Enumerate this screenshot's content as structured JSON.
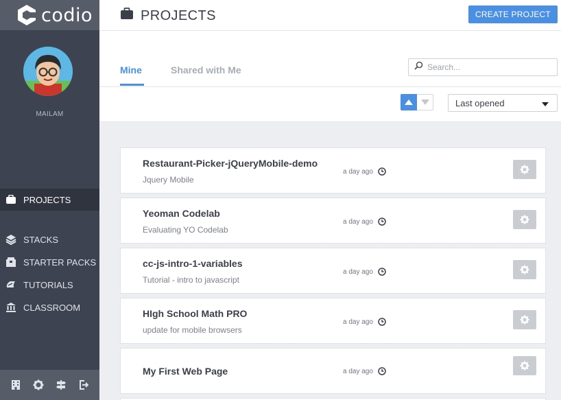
{
  "app": {
    "logo_text": "codio"
  },
  "sidebar": {
    "username": "MAILAM",
    "items": [
      {
        "label": "PROJECTS",
        "icon": "briefcase-icon",
        "active": true
      },
      {
        "label": "STACKS",
        "icon": "layers-icon"
      },
      {
        "label": "STARTER PACKS",
        "icon": "box-icon"
      },
      {
        "label": "TUTORIALS",
        "icon": "graduation-icon"
      },
      {
        "label": "CLASSROOM",
        "icon": "institution-icon"
      }
    ],
    "bottom_icons": [
      "building-icon",
      "gear-icon",
      "signpost-icon",
      "logout-icon"
    ]
  },
  "header": {
    "title": "PROJECTS",
    "create_button": "CREATE PROJECT"
  },
  "tabs": {
    "mine": "Mine",
    "shared": "Shared with Me",
    "active": "Mine"
  },
  "search": {
    "placeholder": "Search..."
  },
  "sort": {
    "selected": "Last opened",
    "direction": "ascending"
  },
  "projects": [
    {
      "name": "Restaurant-Picker-jQueryMobile-demo",
      "description": "Jquery Mobile",
      "time": "a day ago"
    },
    {
      "name": "Yeoman Codelab",
      "description": "Evaluating YO Codelab",
      "time": "a day ago"
    },
    {
      "name": "cc-js-intro-1-variables",
      "description": "Tutorial - intro to javascript",
      "time": "a day ago"
    },
    {
      "name": "HIgh School Math PRO",
      "description": "update for mobile browsers",
      "time": "a day ago"
    },
    {
      "name": "My First Web Page",
      "description": "",
      "time": "a day ago"
    }
  ],
  "colors": {
    "accent": "#4b8fe2",
    "sidebar": "#3d4350",
    "sidebar_active": "#2f343f"
  }
}
